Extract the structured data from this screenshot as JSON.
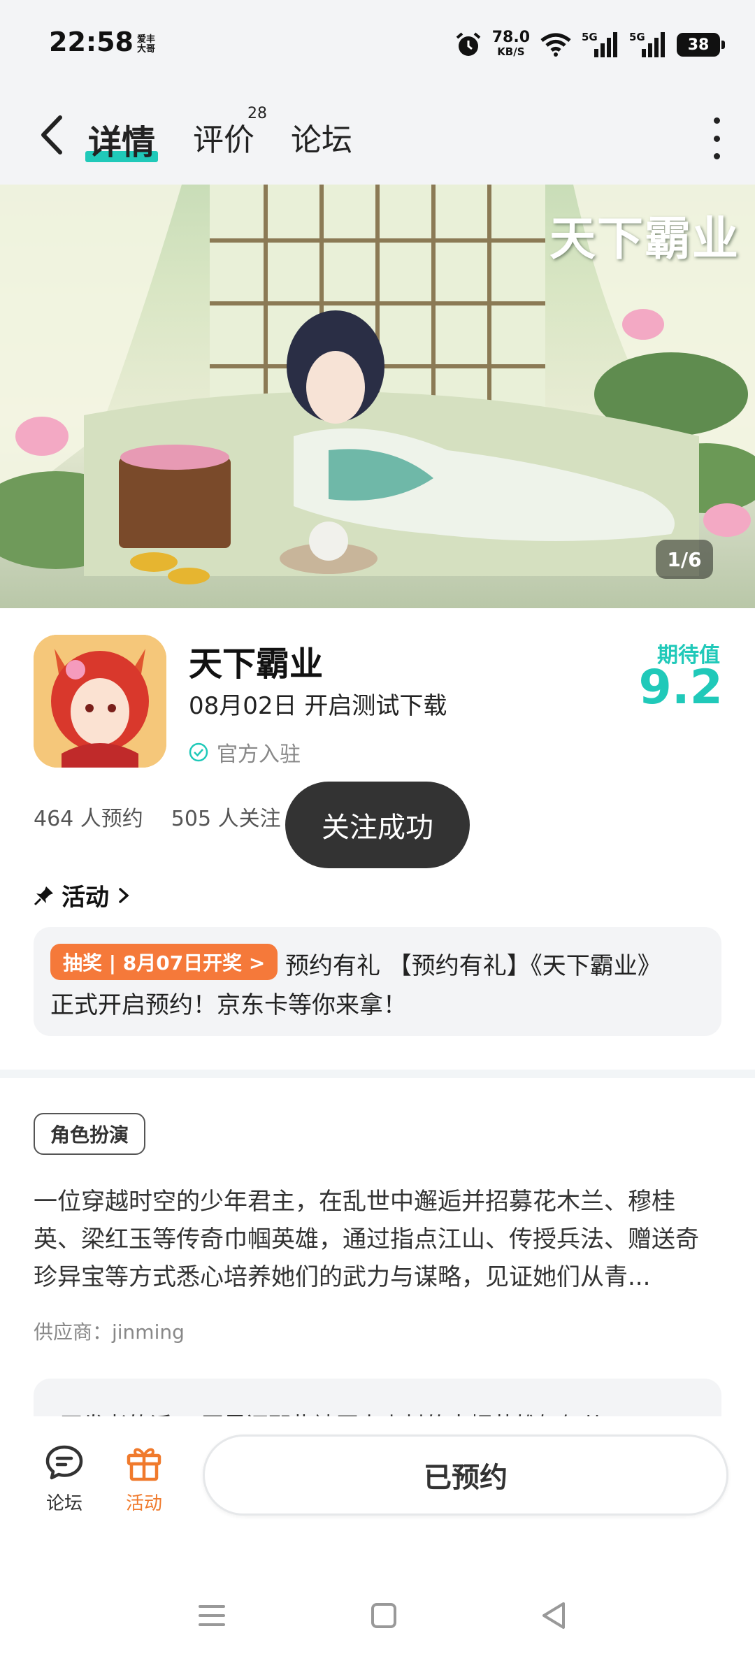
{
  "status_bar": {
    "time": "22:58",
    "carrier": "爱丰大哥",
    "net_speed": "78.0",
    "net_unit": "KB/S",
    "signal1": "5G",
    "signal2": "5G",
    "battery": "38"
  },
  "nav": {
    "tab_detail": "详情",
    "tab_reviews": "评价",
    "reviews_count": "28",
    "tab_forum": "论坛"
  },
  "banner": {
    "logo_text": "天下霸业",
    "counter": "1/6"
  },
  "game": {
    "title": "天下霸业",
    "date_text": "08月02日 开启测试下载",
    "official_label": "官方入驻",
    "expect_label": "期待值",
    "expect_score": "9.2",
    "reservations": "464 人预约",
    "follows": "505 人关注"
  },
  "toast": {
    "text": "关注成功"
  },
  "activity": {
    "header": "活动",
    "tag": "抽奖 | 8月07日开奖 >",
    "line1": "预约有礼 【预约有礼】《天下霸业》",
    "line2": "正式开启预约！京东卡等你来拿！"
  },
  "description": {
    "genre": "角色扮演",
    "text": "一位穿越时空的少年君主，在乱世中邂逅并招募花木兰、穆桂英、梁红玉等传奇巾帼英雄，通过指点江山、传授兵法、赠送奇珍异宝等方式悉心培养她们的武力与谋略，见证她们从青...",
    "supplier": "供应商：jinming",
    "dev_note": "开发者的话　 同界还那些被历史尘封的巾帼英雄如何从"
  },
  "bottom_bar": {
    "forum_label": "论坛",
    "activity_label": "活动",
    "reserve_label": "已预约"
  },
  "colors": {
    "accent": "#20c9b9",
    "orange": "#f5793a",
    "toast_bg": "#333333"
  }
}
